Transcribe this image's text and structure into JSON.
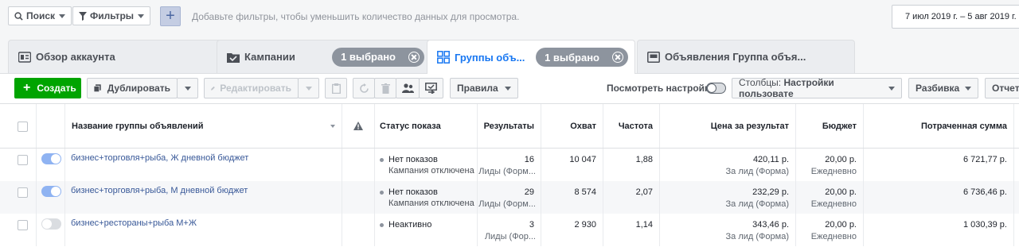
{
  "filters": {
    "search_label": "Поиск",
    "filters_label": "Фильтры",
    "add_label": "+",
    "hint": "Добавьте фильтры, чтобы уменьшить количество данных для просмотра.",
    "date_range": "7 июл 2019 г. – 5 авг 2019 г."
  },
  "tabs": [
    {
      "label": "Обзор аккаунта",
      "icon": "account-overview-icon"
    },
    {
      "label": "Кампании",
      "icon": "folder-check-icon",
      "chip": "1 выбрано"
    },
    {
      "label": "Группы объ...",
      "icon": "grid-icon",
      "chip": "1 выбрано",
      "active": true
    },
    {
      "label": "Объявления Группа объя...",
      "icon": "ad-icon"
    }
  ],
  "toolbar": {
    "create": "Создать",
    "duplicate": "Дублировать",
    "edit": "Редактировать",
    "rules": "Правила",
    "view_settings": "Посмотреть настройки",
    "columns_prefix": "Столбцы:",
    "columns_value": "Настройки пользовате",
    "breakdown": "Разбивка",
    "reports": "Отчет"
  },
  "table": {
    "headers": {
      "name": "Название группы объявлений",
      "status": "Статус показа",
      "results": "Результаты",
      "reach": "Охват",
      "frequency": "Частота",
      "cost": "Цена за результат",
      "budget": "Бюджет",
      "spent": "Потраченная сумма"
    },
    "rows": [
      {
        "on": true,
        "name": "бизнес+торговля+рыба, Ж дневной бюджет",
        "status": "Нет показов",
        "status_sub": "Кампания отключена",
        "results": "16",
        "results_sub": "Лиды (Форм...",
        "reach": "10 047",
        "frequency": "1,88",
        "cost": "420,11 р.",
        "cost_sub": "За лид (Форма)",
        "budget": "20,00 р.",
        "budget_sub": "Ежедневно",
        "spent": "6 721,77 р."
      },
      {
        "on": true,
        "name": "бизнес+торговля+рыба, М дневной бюджет",
        "status": "Нет показов",
        "status_sub": "Кампания отключена",
        "results": "29",
        "results_sub": "Лиды (Форм...",
        "reach": "8 574",
        "frequency": "2,07",
        "cost": "232,29 р.",
        "cost_sub": "За лид (Форма)",
        "budget": "20,00 р.",
        "budget_sub": "Ежедневно",
        "spent": "6 736,46 р."
      },
      {
        "on": false,
        "name": "бизнес+рестораны+рыба М+Ж",
        "status": "Неактивно",
        "status_sub": "",
        "results": "3",
        "results_sub": "Лиды (Фор...",
        "reach": "2 930",
        "frequency": "1,14",
        "cost": "343,46 р.",
        "cost_sub": "За лид (Форма)",
        "budget": "20,00 р.",
        "budget_sub": "Ежедневно",
        "spent": "1 030,39 р."
      }
    ]
  },
  "colors": {
    "accent": "#1877f2",
    "create": "#00a400",
    "toggle_on": "#8fb3f2",
    "toggle_off": "#dadde1"
  }
}
